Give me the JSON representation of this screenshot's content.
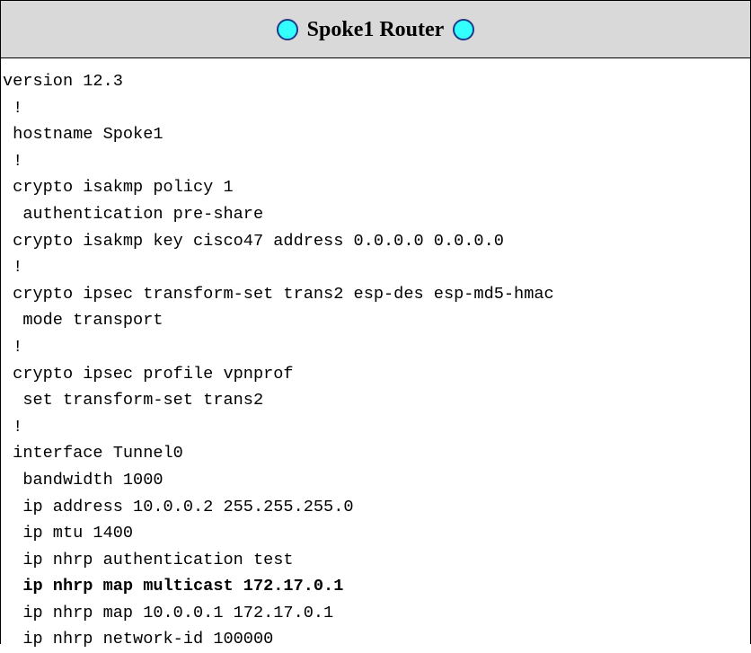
{
  "header": {
    "title": "Spoke1 Router",
    "left_icon": "cyan-circle-icon",
    "right_icon": "cyan-circle-icon",
    "background": "#d9d9d9",
    "icon_color": "#33ffff"
  },
  "config": {
    "lines": [
      {
        "text": "version 12.3",
        "bold": false
      },
      {
        "text": " !",
        "bold": false
      },
      {
        "text": " hostname Spoke1",
        "bold": false
      },
      {
        "text": " !",
        "bold": false
      },
      {
        "text": " crypto isakmp policy 1",
        "bold": false
      },
      {
        "text": "  authentication pre-share",
        "bold": false
      },
      {
        "text": " crypto isakmp key cisco47 address 0.0.0.0 0.0.0.0",
        "bold": false
      },
      {
        "text": " !",
        "bold": false
      },
      {
        "text": " crypto ipsec transform-set trans2 esp-des esp-md5-hmac",
        "bold": false
      },
      {
        "text": "  mode transport",
        "bold": false
      },
      {
        "text": " !",
        "bold": false
      },
      {
        "text": " crypto ipsec profile vpnprof",
        "bold": false
      },
      {
        "text": "  set transform-set trans2",
        "bold": false
      },
      {
        "text": " !",
        "bold": false
      },
      {
        "text": " interface Tunnel0",
        "bold": false
      },
      {
        "text": "  bandwidth 1000",
        "bold": false
      },
      {
        "text": "  ip address 10.0.0.2 255.255.255.0",
        "bold": false
      },
      {
        "text": "  ip mtu 1400",
        "bold": false
      },
      {
        "text": "  ip nhrp authentication test",
        "bold": false
      },
      {
        "text": "  ip nhrp map multicast 172.17.0.1",
        "bold": true
      },
      {
        "text": "  ip nhrp map 10.0.0.1 172.17.0.1",
        "bold": false
      },
      {
        "text": "  ip nhrp network-id 100000",
        "bold": false
      }
    ]
  }
}
